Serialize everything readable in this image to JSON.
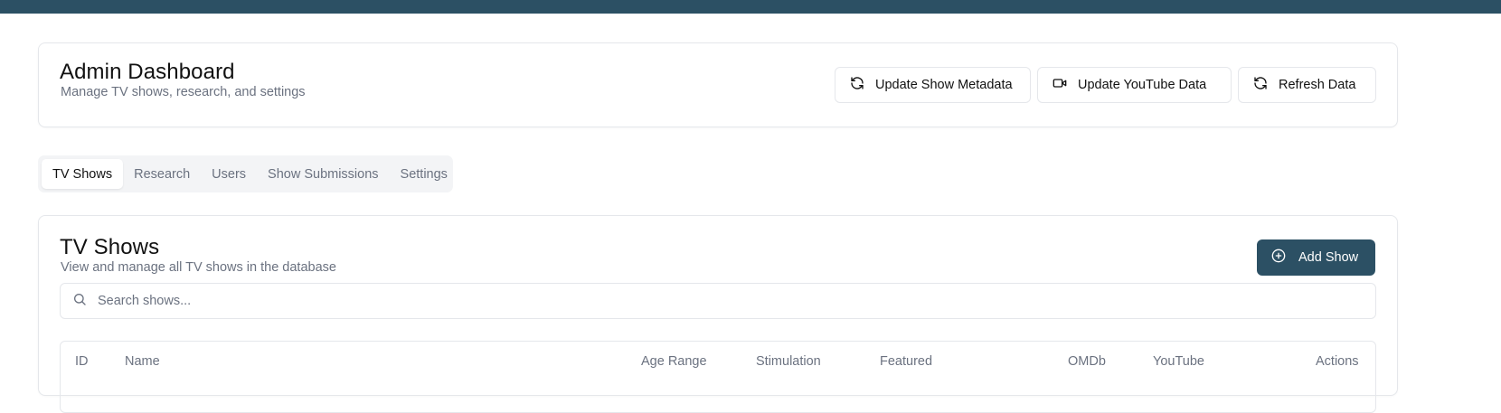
{
  "header": {
    "title": "Admin Dashboard",
    "subtitle": "Manage TV shows, research, and settings",
    "buttons": {
      "update_metadata": "Update Show Metadata",
      "update_youtube": "Update YouTube Data",
      "refresh": "Refresh Data"
    }
  },
  "tabs": [
    "TV Shows",
    "Research",
    "Users",
    "Show Submissions",
    "Settings"
  ],
  "active_tab": "TV Shows",
  "shows": {
    "title": "TV Shows",
    "subtitle": "View and manage all TV shows in the database",
    "add_button": "Add Show",
    "search_placeholder": "Search shows...",
    "columns": [
      "ID",
      "Name",
      "Age Range",
      "Stimulation",
      "Featured",
      "OMDb",
      "YouTube",
      "Actions"
    ]
  },
  "icons": {
    "refresh": "refresh-icon",
    "video": "video-icon",
    "add": "plus-circle-icon",
    "search": "search-icon"
  },
  "colors": {
    "brand": "#2c5064",
    "muted_text": "#6b7280",
    "border": "#e5e7eb",
    "tab_bg": "#f3f4f6"
  }
}
